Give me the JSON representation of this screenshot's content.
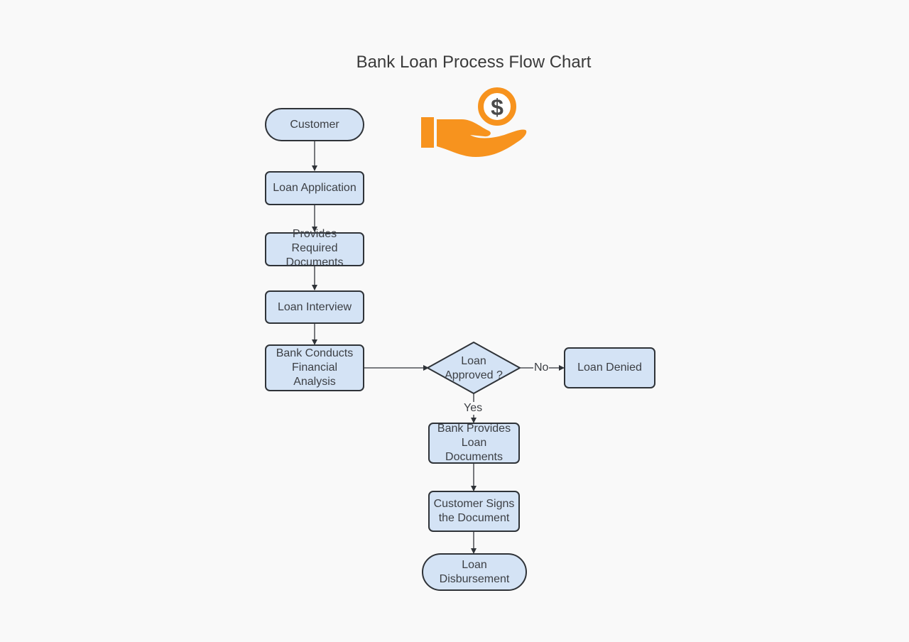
{
  "title": "Bank Loan Process Flow Chart",
  "icon": "hand-holding-dollar-icon",
  "colors": {
    "node_fill": "#d4e3f5",
    "node_stroke": "#2f3338",
    "icon_orange": "#f7931e",
    "icon_dollar": "#4a4a4a",
    "text": "#3c3f44"
  },
  "nodes": {
    "customer": "Customer",
    "loan_application": "Loan Application",
    "provides_documents": "Provides Required Documents",
    "loan_interview": "Loan Interview",
    "financial_analysis": "Bank Conducts Financial Analysis",
    "decision": "Loan Approved ?",
    "loan_denied": "Loan Denied",
    "bank_provides_documents": "Bank Provides Loan Documents",
    "customer_signs": "Customer Signs the Document",
    "disbursement": "Loan Disbursement"
  },
  "edge_labels": {
    "no": "No",
    "yes": "Yes"
  }
}
